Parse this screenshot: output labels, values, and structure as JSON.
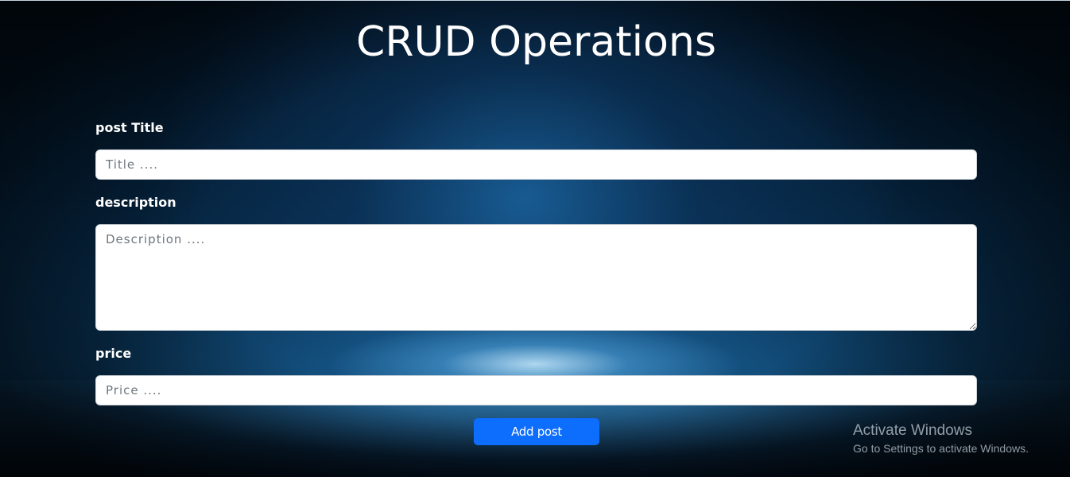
{
  "page": {
    "title": "CRUD Operations"
  },
  "form": {
    "title_label": "post Title",
    "title_placeholder": "Title ....",
    "description_label": "description",
    "description_placeholder": "Description ....",
    "price_label": "price",
    "price_placeholder": "Price ....",
    "submit_label": "Add post"
  },
  "windows_watermark": {
    "title": "Activate Windows",
    "subtitle": "Go to Settings to activate Windows."
  },
  "colors": {
    "button_primary": "#0d6efd",
    "heading_text": "#ffffff",
    "background_glow": "#1e6eaf"
  }
}
